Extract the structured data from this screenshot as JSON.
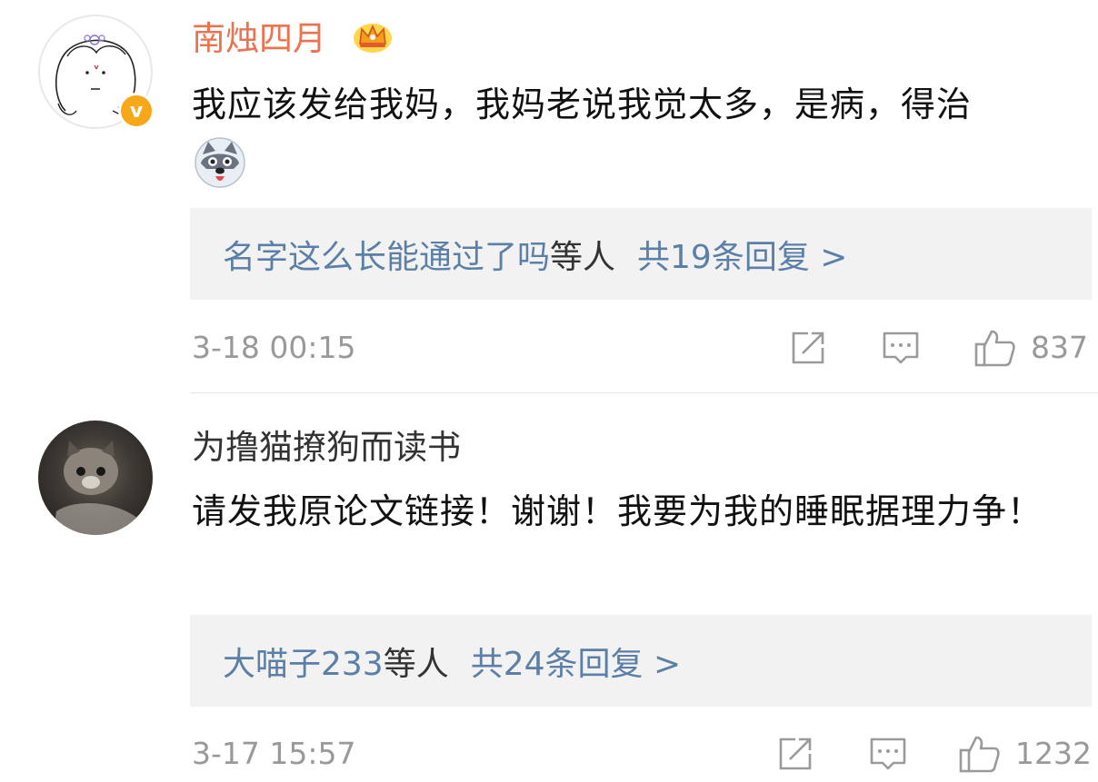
{
  "comments": [
    {
      "username": "南烛四月",
      "user_badge_icon": "crown-icon",
      "verified_icon": "verified-v-icon",
      "verified_mark": "v",
      "text": "我应该发给我妈，我妈老说我觉太多，是病，得治",
      "emoji_icon": "husky-emoji-icon",
      "reply_names": "名字这么长能通过了吗",
      "reply_suffix": "等人",
      "reply_count": "共19条回复 >",
      "time": "3-18 00:15",
      "likes": "837",
      "username_color": "#eb7350"
    },
    {
      "username": "为撸猫撩狗而读书",
      "text": "请发我原论文链接！谢谢！我要为我的睡眠据理力争！",
      "reply_names": "大喵子233",
      "reply_suffix": "等人",
      "reply_count": "共24条回复 >",
      "time": "3-17 15:57",
      "likes": "1232",
      "username_color": "#333333"
    }
  ],
  "colors": {
    "link": "#5b7fa6",
    "meta": "#999999",
    "reply_bg": "#f2f2f2",
    "verified": "#f7a818"
  },
  "icons": [
    "share-icon",
    "comment-icon",
    "like-icon"
  ]
}
